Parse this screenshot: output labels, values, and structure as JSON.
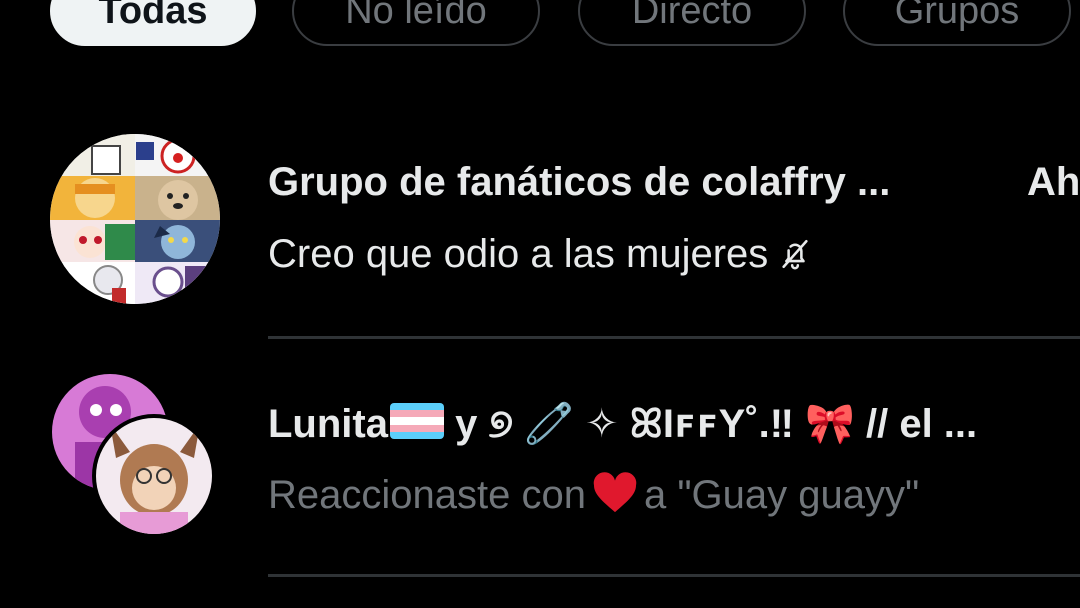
{
  "filters": {
    "chips": [
      {
        "label": "Todas",
        "active": true
      },
      {
        "label": "No leído",
        "active": false
      },
      {
        "label": "Directo",
        "active": false
      },
      {
        "label": "Grupos",
        "active": false
      }
    ]
  },
  "conversations": [
    {
      "name": "Grupo de fanáticos de colaffry ...",
      "time": "Ah",
      "preview": "Creo que odio a las mujeres",
      "muted_icon": "bell-off-icon",
      "avatar": "group-avatar-collage"
    },
    {
      "name_prefix": "Lunita",
      "name_suffix": " y ୭ 🧷 ✧ ꕤIꜰꜰY˚.‼ 🎀 // el ...",
      "preview_before": "Reaccionaste con",
      "preview_after": "a \"Guay guayy\"",
      "reaction_icon": "red-heart-icon",
      "avatar": "stacked-avatars"
    }
  ],
  "colors": {
    "background": "#000000",
    "text_primary": "#e7e9ea",
    "text_secondary": "#71767b",
    "divider": "#2f3336",
    "chip_active_bg": "#eff3f4",
    "heart": "#e0182d"
  }
}
